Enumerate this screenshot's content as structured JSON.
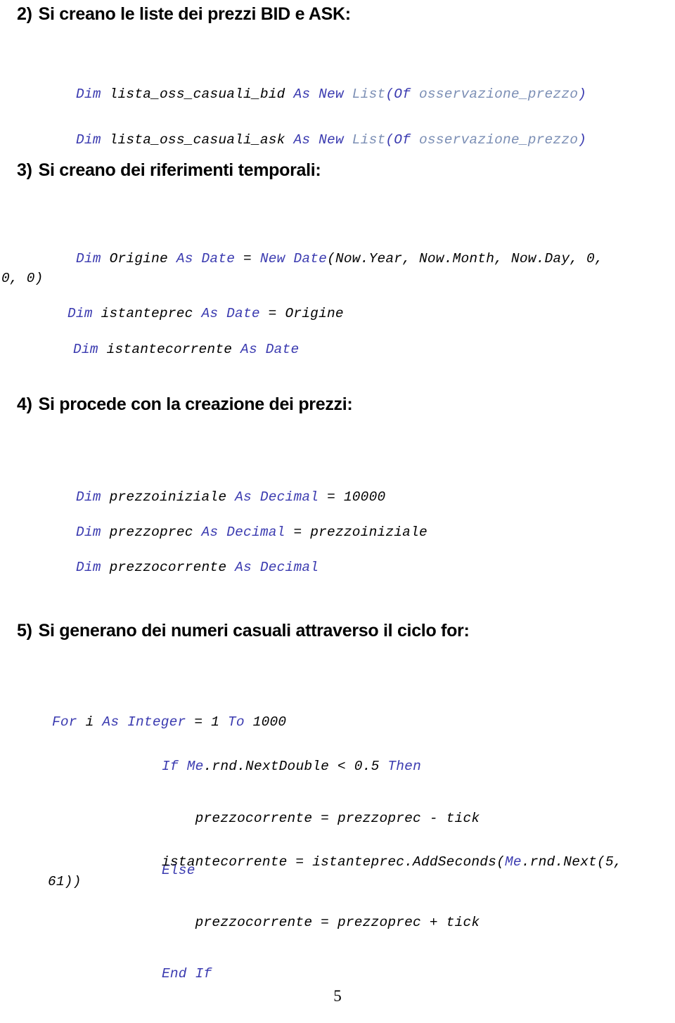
{
  "document": {
    "page_number": "5",
    "language": "it",
    "colors": {
      "keyword": "#3b3bb0",
      "type": "#7c8fb5",
      "plain": "#000000",
      "background": "#ffffff"
    }
  },
  "sections": [
    {
      "id": "step-2",
      "number": "2)",
      "title": "Si creano le liste dei prezzi BID e ASK:",
      "code_lines": [
        "Dim lista_oss_casuali_bid As New List(Of osservazione_prezzo)",
        "Dim lista_oss_casuali_ask As New List(Of osservazione_prezzo)"
      ]
    },
    {
      "id": "step-3",
      "number": "3)",
      "title": "Si creano dei riferimenti temporali:",
      "code_lines": [
        "Dim Origine As Date = New Date(Now.Year, Now.Month, Now.Day, 0, 0, 0)",
        "Dim istanteprec As Date = Origine",
        "Dim istantecorrente As Date"
      ],
      "wrap_fragment": "0, 0)"
    },
    {
      "id": "step-4",
      "number": "4)",
      "title": "Si procede con la creazione dei prezzi:",
      "code_lines": [
        "Dim prezzoiniziale As Decimal = 10000",
        "Dim prezzoprec As Decimal = prezzoiniziale",
        "Dim prezzocorrente As Decimal"
      ]
    },
    {
      "id": "step-5",
      "number": "5)",
      "title": "Si generano dei numeri casuali attraverso il ciclo for:",
      "code_lines": [
        "For i As Integer = 1 To 1000",
        "If Me.rnd.NextDouble < 0.5 Then",
        "    prezzocorrente = prezzoprec - tick",
        "Else",
        "    prezzocorrente = prezzoprec + tick",
        "End If",
        "istantecorrente = istanteprec.AddSeconds(Me.rnd.Next(5, 61))"
      ],
      "wrap_fragment": "61))"
    }
  ],
  "code_tokens": {
    "s2_line1": {
      "kw1": "Dim ",
      "id1": "lista_oss_casuali_bid ",
      "kw2": "As New ",
      "type1": "List",
      "kw3": "(Of ",
      "type2": "osservazione_prezzo",
      "kw4": ")"
    },
    "s2_line2": {
      "kw1": "Dim ",
      "id1": "lista_oss_casuali_ask ",
      "kw2": "As New ",
      "type1": "List",
      "kw3": "(Of ",
      "type2": "osservazione_prezzo",
      "kw4": ")"
    },
    "s3_line1": {
      "kw1": "Dim ",
      "id1": "Origine ",
      "kw2": "As Date ",
      "op1": "= ",
      "kw3": "New Date",
      "id2": "(Now.Year, Now.Month, Now.Day, 0,"
    },
    "s3_wrap": "0, 0)",
    "s3_line2": {
      "kw1": "Dim ",
      "id1": "istanteprec ",
      "kw2": "As Date ",
      "op1": "= ",
      "id2": "Origine"
    },
    "s3_line3": {
      "kw1": "Dim ",
      "id1": "istantecorrente ",
      "kw2": "As Date"
    },
    "s4_line1": {
      "kw1": "Dim ",
      "id1": "prezzoiniziale ",
      "kw2": "As Decimal ",
      "id2": "= 10000"
    },
    "s4_line2": {
      "kw1": "Dim ",
      "id1": "prezzoprec ",
      "kw2": "As Decimal ",
      "id2": "= prezzoiniziale"
    },
    "s4_line3": {
      "kw1": "Dim ",
      "id1": "prezzocorrente ",
      "kw2": "As Decimal"
    },
    "s5_for": {
      "kw1": "For ",
      "id1": "i ",
      "kw2": "As Integer ",
      "id2": "= 1 ",
      "kw3": "To ",
      "id3": "1000"
    },
    "s5_if": {
      "kw1": "If ",
      "kw2": "Me",
      "id1": ".rnd.NextDouble < 0.5 ",
      "kw3": "Then"
    },
    "s5_then_body": "    prezzocorrente = prezzoprec - tick",
    "s5_else": "Else",
    "s5_else_body": "    prezzocorrente = prezzoprec + tick",
    "s5_endif": "End If",
    "s5_last": {
      "id1": "istantecorrente = istanteprec.AddSeconds(",
      "kw1": "Me",
      "id2": ".rnd.Next(5,"
    },
    "s5_wrap": "61))"
  }
}
